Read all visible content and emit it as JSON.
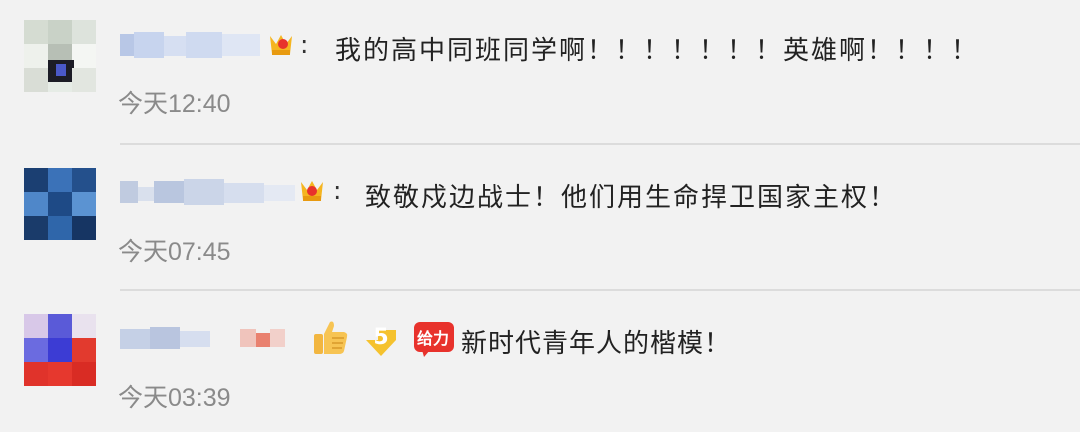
{
  "comments": [
    {
      "colon": ":",
      "text": "我的高中同班同学啊！！！！！！！英雄啊！！！！",
      "time": "今天12:40",
      "badge_icon": "vip-crown-icon"
    },
    {
      "colon": ":",
      "text": "致敬戍边战士！他们用生命捍卫国家主权！",
      "time": "今天07:45",
      "badge_icon": "vip-crown-icon"
    },
    {
      "emojis": [
        "thumbs-up-emoji",
        "five-star-emoji",
        "awesome-emoji"
      ],
      "awesome_emoji_text": "给力",
      "text": "新时代青年人的楷模！",
      "time": "今天03:39"
    }
  ],
  "colors": {
    "background": "#f2f2f2",
    "text": "#222222",
    "time": "#8a8a8a",
    "divider": "#dcdcdc",
    "accent_red": "#e8322c",
    "accent_gold": "#f5b520"
  }
}
